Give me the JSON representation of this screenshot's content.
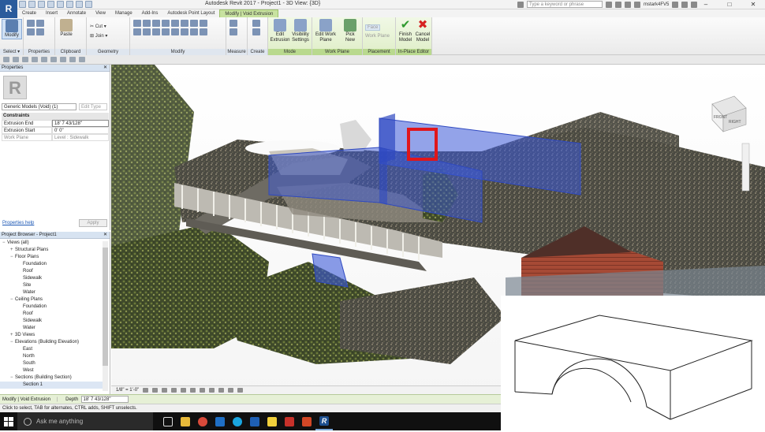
{
  "window": {
    "title": "Autodesk Revit 2017 -     Project1 - 3D View: {3D}",
    "search_placeholder": "Type a keyword or phrase",
    "user": "mstark4FV5",
    "app_letter": "R"
  },
  "ribbon_tabs": [
    "Create",
    "Insert",
    "Annotate",
    "View",
    "Manage",
    "Add-Ins",
    "Autodesk Point Layout",
    "Modify | Void Extrusion"
  ],
  "ribbon": {
    "select_label": "Select ▾",
    "modify_label": "Modify",
    "clip_paste": "Paste",
    "geom_cut": "Cut",
    "geom_join": "Join",
    "buttons": {
      "edit_extrusion": "Edit Extrusion",
      "visibility_settings": "Visibility Settings",
      "edit_work_plane": "Edit Work Plane",
      "pick_new": "Pick New",
      "face": "Face",
      "work_plane": "Work Plane",
      "finish_model": "Finish Model",
      "cancel_model": "Cancel Model"
    },
    "panels": {
      "properties": "Properties",
      "clipboard": "Clipboard",
      "geometry": "Geometry",
      "modify": "Modify",
      "measure": "Measure",
      "create": "Create",
      "mode": "Mode",
      "work_plane": "Work Plane",
      "placement": "Placement",
      "in_place_editor": "In-Place Editor"
    }
  },
  "properties": {
    "title": "Properties",
    "type_selector": "Generic Models (Void) (1)",
    "edit_type": "Edit Type",
    "section": "Constraints",
    "rows": [
      {
        "k": "Extrusion End",
        "v": "18'  7 43/128\""
      },
      {
        "k": "Extrusion Start",
        "v": "0'  0\""
      },
      {
        "k": "Work Plane",
        "v": "Level : Sidewalk"
      }
    ],
    "help": "Properties help",
    "apply": "Apply"
  },
  "project_browser": {
    "title": "Project Browser - Project1",
    "nodes": [
      {
        "label": "Views (all)",
        "level": 0,
        "tog": "−"
      },
      {
        "label": "Structural Plans",
        "level": 1,
        "tog": "+"
      },
      {
        "label": "Floor Plans",
        "level": 1,
        "tog": "−"
      },
      {
        "label": "Foundation",
        "level": 2,
        "tog": ""
      },
      {
        "label": "Roof",
        "level": 2,
        "tog": ""
      },
      {
        "label": "Sidewalk",
        "level": 2,
        "tog": ""
      },
      {
        "label": "Site",
        "level": 2,
        "tog": ""
      },
      {
        "label": "Water",
        "level": 2,
        "tog": ""
      },
      {
        "label": "Ceiling Plans",
        "level": 1,
        "tog": "−"
      },
      {
        "label": "Foundation",
        "level": 2,
        "tog": ""
      },
      {
        "label": "Roof",
        "level": 2,
        "tog": ""
      },
      {
        "label": "Sidewalk",
        "level": 2,
        "tog": ""
      },
      {
        "label": "Water",
        "level": 2,
        "tog": ""
      },
      {
        "label": "3D Views",
        "level": 1,
        "tog": "+"
      },
      {
        "label": "Elevations (Building Elevation)",
        "level": 1,
        "tog": "−"
      },
      {
        "label": "East",
        "level": 2,
        "tog": ""
      },
      {
        "label": "North",
        "level": 2,
        "tog": ""
      },
      {
        "label": "South",
        "level": 2,
        "tog": ""
      },
      {
        "label": "West",
        "level": 2,
        "tog": ""
      },
      {
        "label": "Sections (Building Section)",
        "level": 1,
        "tog": "−"
      },
      {
        "label": "Section 1",
        "level": 2,
        "tog": ""
      }
    ]
  },
  "view": {
    "scale": "1/8\" = 1'-0\"",
    "viewcube_front": "FRONT",
    "viewcube_right": "RIGHT"
  },
  "options_bar": {
    "context": "Modify | Void Extrusion",
    "depth_label": "Depth",
    "depth_value": "18'  7 43/128\""
  },
  "status_bar": "Click to select, TAB for alternates, CTRL adds, SHIFT unselects.",
  "taskbar": {
    "search": "Ask me anything"
  },
  "colors": {
    "void_blue": "#3c5ad8",
    "highlight_red": "#e0161b",
    "context_green": "#c8e2a0"
  }
}
